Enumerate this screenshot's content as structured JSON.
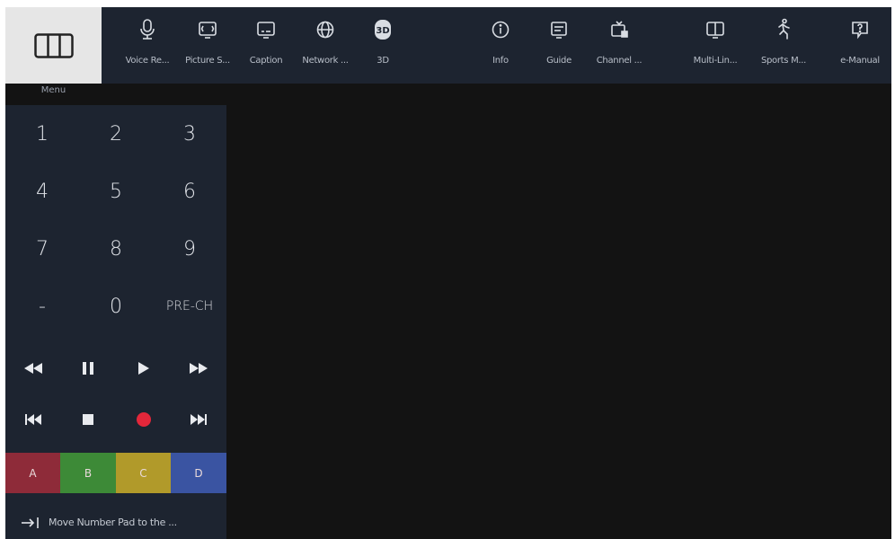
{
  "menu": {
    "label": "Menu"
  },
  "toolbar": [
    {
      "label": "Voice Re...",
      "icon": "microphone-icon"
    },
    {
      "label": "Picture S...",
      "icon": "picture-size-icon"
    },
    {
      "label": "Caption",
      "icon": "caption-icon"
    },
    {
      "label": "Network ...",
      "icon": "globe-icon"
    },
    {
      "label": "3D",
      "icon": "3d-icon"
    },
    {
      "label": "Info",
      "icon": "info-icon"
    },
    {
      "label": "Guide",
      "icon": "guide-icon"
    },
    {
      "label": "Channel ...",
      "icon": "channel-list-icon"
    },
    {
      "label": "Multi-Lin...",
      "icon": "multi-link-icon"
    },
    {
      "label": "Sports M...",
      "icon": "sports-mode-icon"
    },
    {
      "label": "e-Manual",
      "icon": "e-manual-icon"
    }
  ],
  "numpad": [
    "1",
    "2",
    "3",
    "4",
    "5",
    "6",
    "7",
    "8",
    "9",
    "-",
    "0",
    "PRE-CH"
  ],
  "media_controls": [
    "rewind-icon",
    "pause-icon",
    "play-icon",
    "fast-forward-icon",
    "previous-icon",
    "stop-icon",
    "record-icon",
    "next-icon"
  ],
  "color_buttons": [
    {
      "label": "A",
      "color": "#8e2b39"
    },
    {
      "label": "B",
      "color": "#3d8a37"
    },
    {
      "label": "C",
      "color": "#b19a2a"
    },
    {
      "label": "D",
      "color": "#3a54a2"
    }
  ],
  "move_pad": {
    "label": "Move Number Pad to the ...",
    "icon": "move-right-icon"
  },
  "colors": {
    "record": "#e3273a",
    "panel": "#1d2430",
    "background": "#131313"
  }
}
